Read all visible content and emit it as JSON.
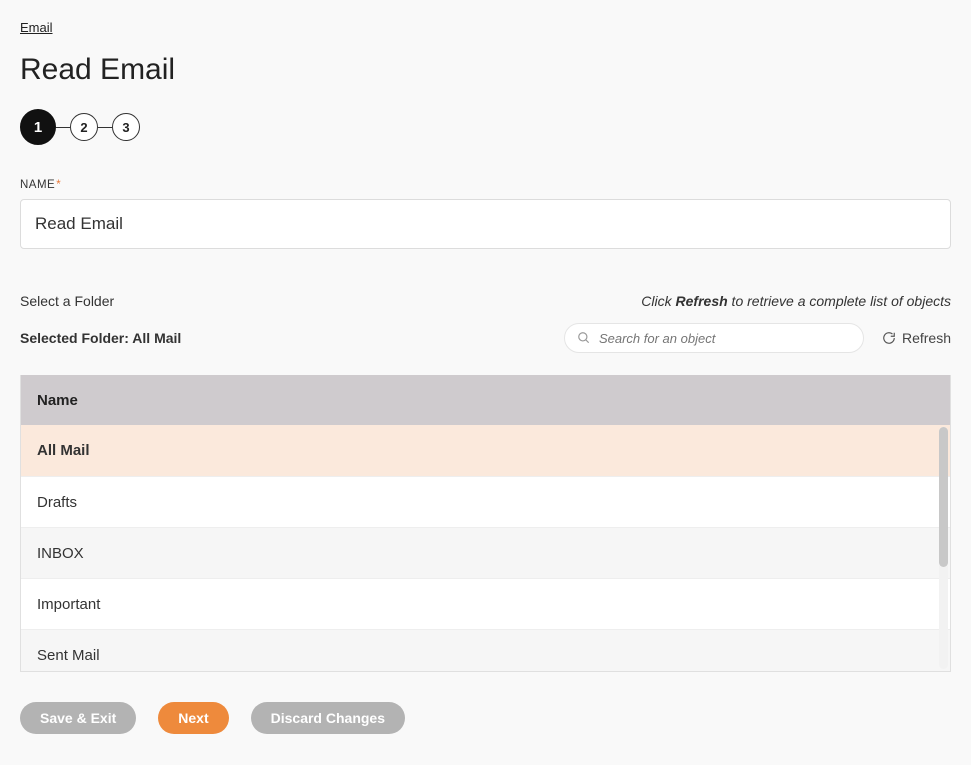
{
  "breadcrumb": {
    "email": "Email"
  },
  "title": "Read Email",
  "steps": [
    "1",
    "2",
    "3"
  ],
  "activeStep": 0,
  "nameField": {
    "label": "NAME",
    "required": "*",
    "value": "Read Email"
  },
  "folderSection": {
    "selectLabel": "Select a Folder",
    "hintPrefix": "Click ",
    "hintBold": "Refresh",
    "hintSuffix": " to retrieve a complete list of objects",
    "selectedLabel": "Selected Folder: ",
    "selectedValue": "All Mail"
  },
  "search": {
    "placeholder": "Search for an object"
  },
  "refresh": {
    "label": "Refresh"
  },
  "table": {
    "header": "Name",
    "rows": [
      {
        "name": "All Mail",
        "selected": true
      },
      {
        "name": "Drafts",
        "selected": false
      },
      {
        "name": "INBOX",
        "selected": false
      },
      {
        "name": "Important",
        "selected": false
      },
      {
        "name": "Sent Mail",
        "selected": false
      }
    ]
  },
  "buttons": {
    "saveExit": "Save & Exit",
    "next": "Next",
    "discard": "Discard Changes"
  }
}
